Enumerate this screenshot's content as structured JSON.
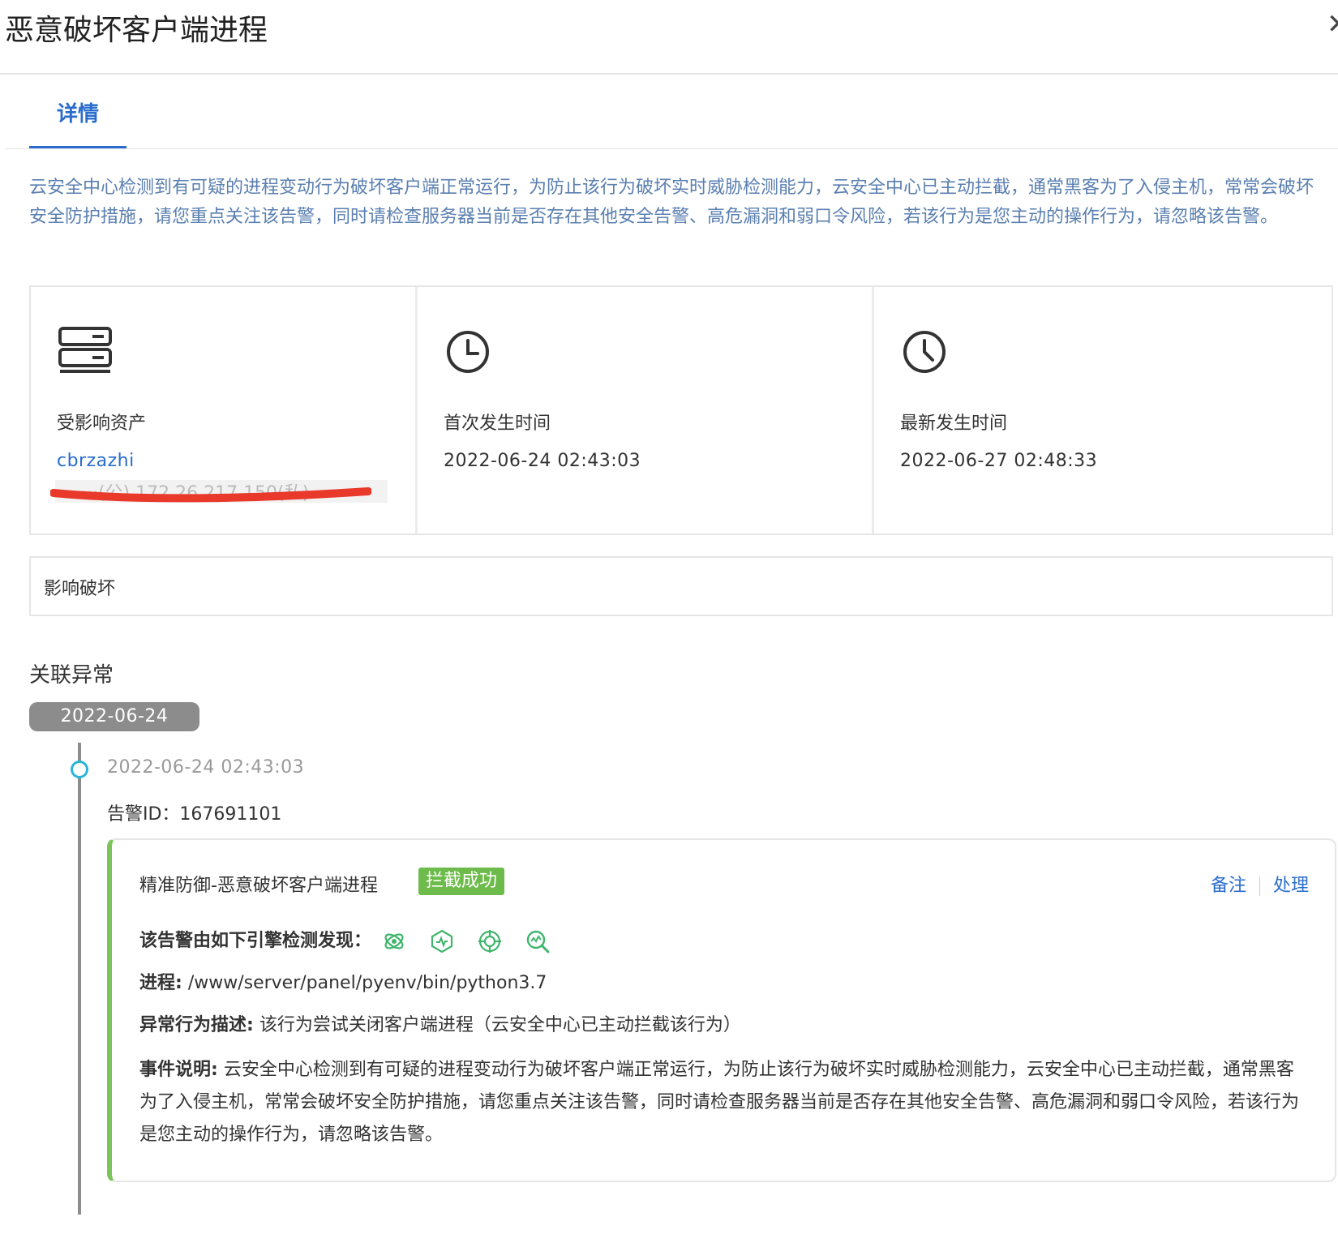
{
  "header": {
    "title": "恶意破坏客户端进程",
    "close_icon": "close-icon",
    "close_glyph": "✕"
  },
  "tabs": [
    {
      "label": "详情",
      "active": true
    }
  ],
  "intro": "云安全中心检测到有可疑的进程变动行为破坏客户端正常运行，为防止该行为破坏实时威胁检测能力，云安全中心已主动拦截，通常黑客为了入侵主机，常常会破坏安全防护措施，请您重点关注该告警，同时请检查服务器当前是否存在其他安全告警、高危漏洞和弱口令风险，若该行为是您主动的操作行为，请忽略该告警。",
  "cards": {
    "asset": {
      "icon": "server-icon",
      "label": "受影响资产",
      "name": "cbrzazhi",
      "ip_redacted": "·······(公) 172.26.217.150(私)"
    },
    "first": {
      "icon": "clock-icon",
      "label": "首次发生时间",
      "value": "2022-06-24 02:43:03"
    },
    "latest": {
      "icon": "clock-icon",
      "label": "最新发生时间",
      "value": "2022-06-27 02:48:33"
    }
  },
  "impact": {
    "label": "影响破坏"
  },
  "related": {
    "title": "关联异常",
    "date_group": "2022-06-24",
    "event": {
      "time": "2022-06-24 02:43:03",
      "alert_id": "告警ID：167691101",
      "card": {
        "title": "精准防御-恶意破坏客户端进程",
        "badge": "拦截成功",
        "note_label": "备注",
        "handle_label": "处理",
        "engines_label": "该告警由如下引擎检测发现：",
        "engine_icons": [
          "behavior-engine-icon",
          "rule-engine-icon",
          "target-engine-icon",
          "analysis-engine-icon"
        ],
        "process_label": "进程:",
        "process_value": "/www/server/panel/pyenv/bin/python3.7",
        "behavior_label": "异常行为描述:",
        "behavior_value": "该行为尝试关闭客户端进程（云安全中心已主动拦截该行为）",
        "event_label": "事件说明:",
        "event_value": "云安全中心检测到有可疑的进程变动行为破坏客户端正常运行，为防止该行为破坏实时威胁检测能力，云安全中心已主动拦截，通常黑客为了入侵主机，常常会破坏安全防护措施，请您重点关注该告警，同时请检查服务器当前是否存在其他安全告警、高危漏洞和弱口令风险，若该行为是您主动的操作行为，请忽略该告警。"
      }
    }
  },
  "colors": {
    "accent": "#2a6dcc",
    "success": "#6dbb4a",
    "timeline_dot": "#2ab5d8",
    "intro_text": "#5a7fb0",
    "redaction": "#e8392a"
  }
}
